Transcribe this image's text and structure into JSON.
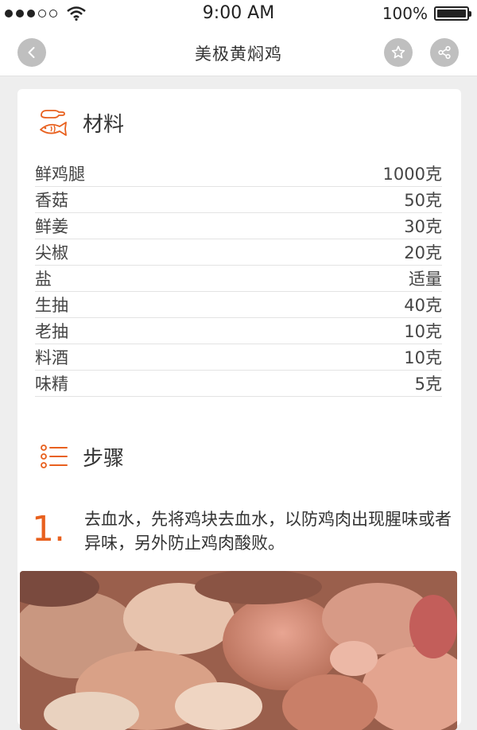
{
  "status_bar": {
    "time": "9:00 AM",
    "battery": "100%",
    "battery_level": 1.0,
    "signal_bars_filled": 3,
    "signal_bars_total": 5
  },
  "nav": {
    "title": "美极黄焖鸡"
  },
  "ingredients": {
    "title": "材料",
    "items": [
      {
        "name": "鲜鸡腿",
        "amount": "1000克"
      },
      {
        "name": "香菇",
        "amount": "50克"
      },
      {
        "name": "鲜姜",
        "amount": "30克"
      },
      {
        "name": "尖椒",
        "amount": "20克"
      },
      {
        "name": "盐",
        "amount": "适量"
      },
      {
        "name": "生抽",
        "amount": "40克"
      },
      {
        "name": "老抽",
        "amount": "10克"
      },
      {
        "name": "料酒",
        "amount": "10克"
      },
      {
        "name": "味精",
        "amount": "5克"
      }
    ]
  },
  "steps": {
    "title": "步骤",
    "items": [
      {
        "number": "1.",
        "text": "去血水，先将鸡块去血水，以防鸡肉出现腥味或者异味，另外防止鸡肉酸败。"
      }
    ]
  },
  "icons": {
    "back": "chevron-left-icon",
    "favorite": "star-icon",
    "share": "share-icon",
    "ingredients": "chicken-fish-icon",
    "steps": "list-icon"
  },
  "colors": {
    "accent": "#e8601e",
    "nav_button": "#bfbfbf"
  }
}
